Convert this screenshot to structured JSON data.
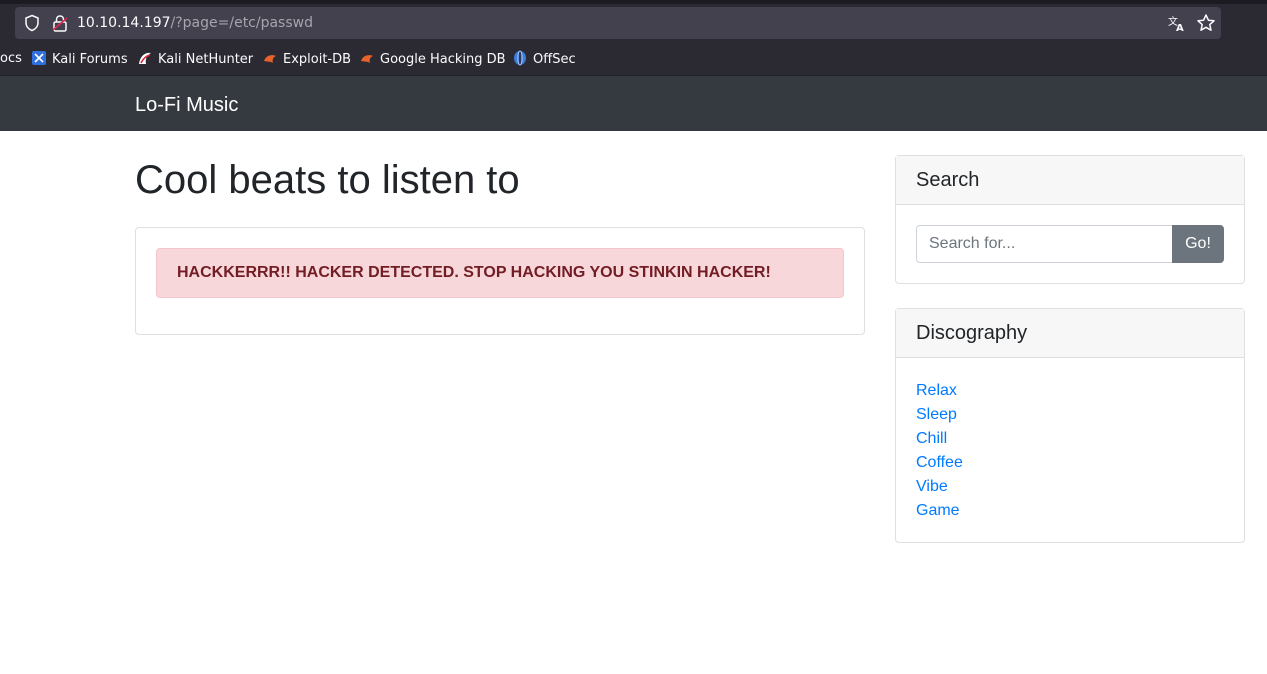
{
  "browser": {
    "url_host": "10.10.14.197",
    "url_path": "/?page=/etc/passwd",
    "bookmarks": [
      {
        "label": "ocs"
      },
      {
        "label": "Kali Forums"
      },
      {
        "label": "Kali NetHunter"
      },
      {
        "label": "Exploit-DB"
      },
      {
        "label": "Google Hacking DB"
      },
      {
        "label": "OffSec"
      }
    ],
    "icons": {
      "shield": "shield-icon",
      "lock": "insecure-lock-icon",
      "translate": "translate-icon",
      "star": "bookmark-star-icon"
    }
  },
  "site": {
    "brand": "Lo-Fi Music",
    "heading": "Cool beats to listen to",
    "alert_text": "HACKKERRR!! HACKER DETECTED. STOP HACKING YOU STINKIN HACKER!",
    "search": {
      "title": "Search",
      "placeholder": "Search for...",
      "button": "Go!"
    },
    "discography": {
      "title": "Discography",
      "items": [
        "Relax",
        "Sleep",
        "Chill",
        "Coffee",
        "Vibe",
        "Game"
      ]
    }
  },
  "colors": {
    "navbar": "#343a40",
    "alert_bg": "#f8d7da",
    "alert_text": "#721c24",
    "link": "#007bff",
    "button": "#6c757d"
  }
}
